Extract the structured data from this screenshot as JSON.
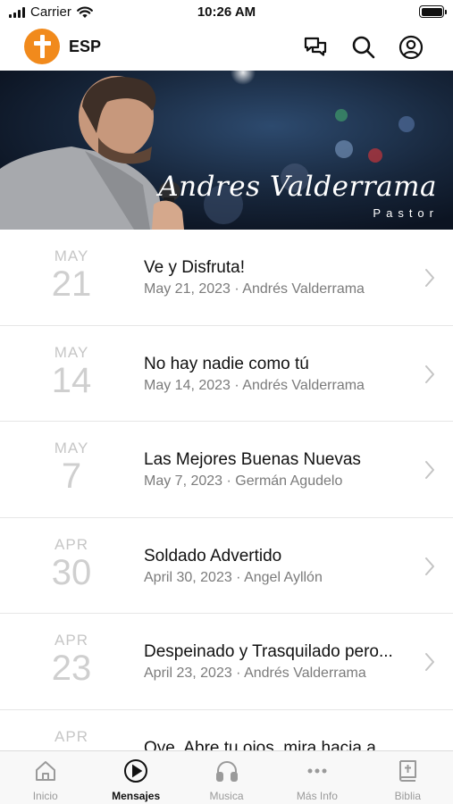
{
  "status_bar": {
    "carrier": "Carrier",
    "time": "10:26 AM"
  },
  "header": {
    "language": "ESP",
    "icons": [
      "chat-icon",
      "search-icon",
      "profile-icon"
    ]
  },
  "banner": {
    "name": "Andres Valderrama",
    "role": "Pastor"
  },
  "messages": [
    {
      "month": "MAY",
      "day": "21",
      "title": "Ve y Disfruta!",
      "subtitle": "May 21, 2023 · Andrés Valderrama"
    },
    {
      "month": "MAY",
      "day": "14",
      "title": "No hay nadie como tú",
      "subtitle": "May 14, 2023 · Andrés Valderrama"
    },
    {
      "month": "MAY",
      "day": "7",
      "title": "Las Mejores Buenas Nuevas",
      "subtitle": "May 7, 2023 · Germán Agudelo"
    },
    {
      "month": "APR",
      "day": "30",
      "title": "Soldado Advertido",
      "subtitle": "April 30, 2023 · Angel Ayllón"
    },
    {
      "month": "APR",
      "day": "23",
      "title": "Despeinado y Trasquilado pero...",
      "subtitle": "April 23, 2023 · Andrés Valderrama"
    },
    {
      "month": "APR",
      "day": "",
      "title": "Oye, Abre tu ojos, mira hacia a",
      "subtitle": ""
    }
  ],
  "tabs": [
    {
      "label": "Inicio",
      "icon": "home-icon",
      "active": false
    },
    {
      "label": "Mensajes",
      "icon": "play-icon",
      "active": true
    },
    {
      "label": "Musica",
      "icon": "headphones-icon",
      "active": false
    },
    {
      "label": "Más Info",
      "icon": "more-icon",
      "active": false
    },
    {
      "label": "Biblia",
      "icon": "bible-icon",
      "active": false
    }
  ],
  "colors": {
    "accent": "#f18a1c",
    "tab_inactive": "#9a9a9a",
    "date_gray": "#c6c6c6"
  }
}
